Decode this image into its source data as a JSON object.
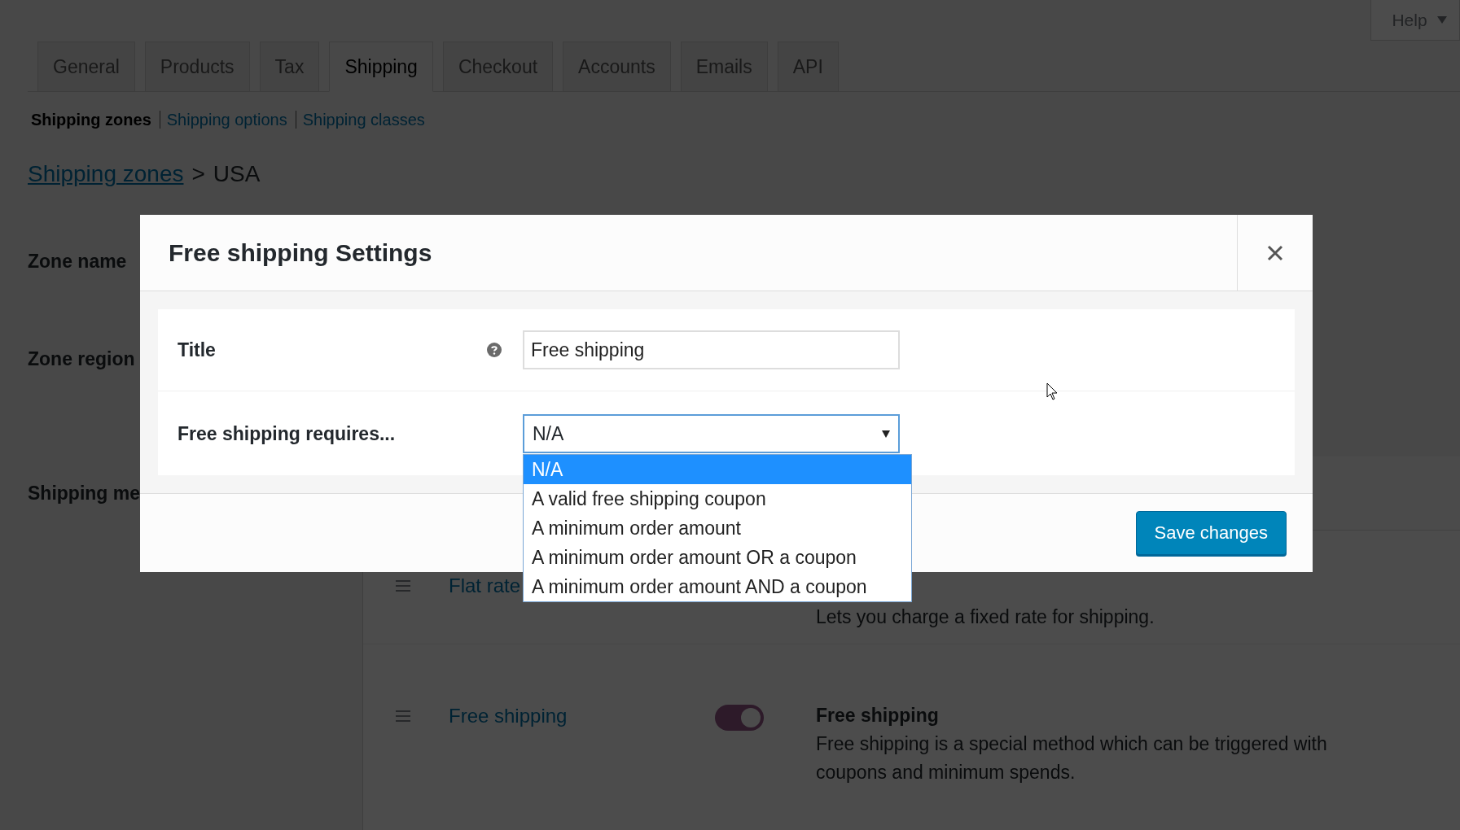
{
  "help_tab": {
    "label": "Help"
  },
  "tabs": [
    {
      "label": "General",
      "selected": false
    },
    {
      "label": "Products",
      "selected": false
    },
    {
      "label": "Tax",
      "selected": false
    },
    {
      "label": "Shipping",
      "selected": true
    },
    {
      "label": "Checkout",
      "selected": false
    },
    {
      "label": "Accounts",
      "selected": false
    },
    {
      "label": "Emails",
      "selected": false
    },
    {
      "label": "API",
      "selected": false
    }
  ],
  "subnav": [
    {
      "label": "Shipping zones",
      "selected": true
    },
    {
      "label": "Shipping options",
      "selected": false
    },
    {
      "label": "Shipping classes",
      "selected": false
    }
  ],
  "breadcrumb": {
    "link": "Shipping zones",
    "separator": ">",
    "current": "USA"
  },
  "zone_labels": [
    "Zone name",
    "Zone region",
    "Shipping me"
  ],
  "methods": [
    {
      "name": "Flat rate",
      "description": "Lets you charge a fixed rate for shipping."
    },
    {
      "name": "Free shipping",
      "enabled": true,
      "title": "Free shipping",
      "description": "Free shipping is a special method which can be triggered with coupons and minimum spends."
    }
  ],
  "modal": {
    "title": "Free shipping Settings",
    "fields": [
      {
        "kind": "text",
        "label": "Title",
        "help": true,
        "value": "Free shipping"
      },
      {
        "kind": "select",
        "label": "Free shipping requires...",
        "value": "N/A",
        "open": true,
        "options": [
          {
            "label": "N/A",
            "selected": true
          },
          {
            "label": "A valid free shipping coupon",
            "selected": false
          },
          {
            "label": "A minimum order amount",
            "selected": false
          },
          {
            "label": "A minimum order amount OR a coupon",
            "selected": false
          },
          {
            "label": "A minimum order amount AND a coupon",
            "selected": false
          }
        ]
      }
    ],
    "save_button": "Save changes"
  }
}
